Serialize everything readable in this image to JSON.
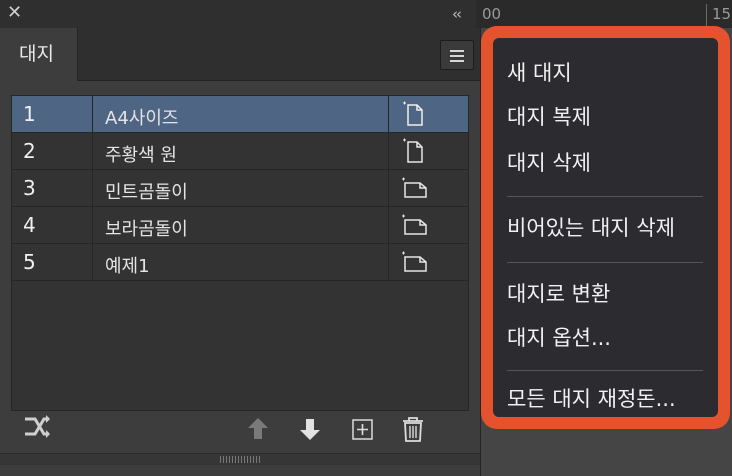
{
  "window": {
    "close_glyph": "✕",
    "collapse_glyph": "‹‹",
    "ruler_text_a": "00",
    "ruler_text_b": "15"
  },
  "panel": {
    "tab_label": "대지",
    "pages": [
      {
        "num": "1",
        "name": "A4사이즈",
        "selected": true,
        "orientation": "portrait"
      },
      {
        "num": "2",
        "name": "주황색 원",
        "selected": false,
        "orientation": "portrait"
      },
      {
        "num": "3",
        "name": "민트곰돌이",
        "selected": false,
        "orientation": "landscape"
      },
      {
        "num": "4",
        "name": "보라곰돌이",
        "selected": false,
        "orientation": "landscape"
      },
      {
        "num": "5",
        "name": "예제1",
        "selected": false,
        "orientation": "landscape"
      }
    ],
    "buttons": {
      "rearrange_icon": "rearrange-artboards-icon",
      "move_up_icon": "arrow-up-icon",
      "move_down_icon": "arrow-down-icon",
      "new_icon": "new-artboard-icon",
      "delete_icon": "trash-icon"
    }
  },
  "menu": {
    "items": [
      {
        "label": "새 대지"
      },
      {
        "label": "대지 복제"
      },
      {
        "label": "대지 삭제"
      },
      {
        "label": "비어있는 대지 삭제"
      },
      {
        "label": "대지로 변환"
      },
      {
        "label": "대지 옵션..."
      },
      {
        "label": "모든 대지 재정돈..."
      }
    ]
  },
  "colors": {
    "selection": "#4e6583",
    "highlight_border": "#e4532e",
    "menu_bg": "#2b2b30",
    "panel_bg": "#3d3d3d"
  }
}
